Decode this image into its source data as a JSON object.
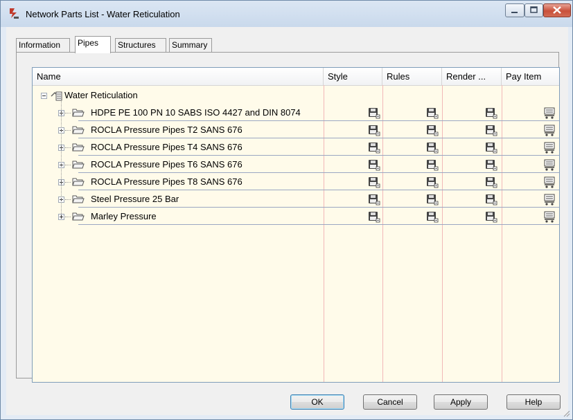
{
  "window": {
    "title": "Network Parts List - Water Reticulation"
  },
  "tabs": [
    {
      "label": "Information",
      "active": false
    },
    {
      "label": "Pipes",
      "active": true
    },
    {
      "label": "Structures",
      "active": false
    },
    {
      "label": "Summary",
      "active": false
    }
  ],
  "grid": {
    "columns": [
      "Name",
      "Style",
      "Rules",
      "Render ...",
      "Pay Item"
    ],
    "root": {
      "label": "Water Reticulation",
      "expanded": true
    },
    "rows": [
      {
        "label": "HDPE PE 100 PN 10 SABS ISO 4427 and DIN 8074"
      },
      {
        "label": "ROCLA Pressure Pipes T2 SANS 676"
      },
      {
        "label": "ROCLA Pressure Pipes T4 SANS 676"
      },
      {
        "label": "ROCLA Pressure Pipes T6 SANS 676"
      },
      {
        "label": "ROCLA Pressure Pipes T8 SANS 676"
      },
      {
        "label": "Steel Pressure 25 Bar"
      },
      {
        "label": "Marley Pressure"
      }
    ],
    "icons": {
      "style": "style-picker-icon",
      "rules": "rules-picker-icon",
      "render": "render-material-picker-icon",
      "pay": "pay-item-picker-icon"
    }
  },
  "buttons": {
    "ok": "OK",
    "cancel": "Cancel",
    "apply": "Apply",
    "help": "Help"
  },
  "colors": {
    "grid_background": "#fffbea",
    "column_divider": "#f2b8b8",
    "titlebar": "#c9d9ec"
  }
}
